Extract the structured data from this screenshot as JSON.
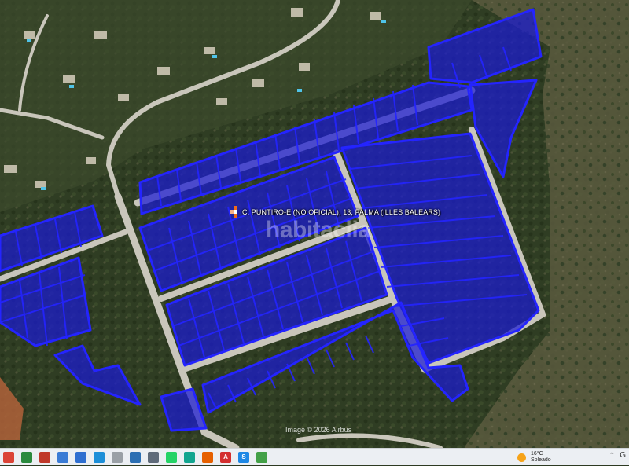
{
  "map": {
    "place_label": "C. PUNTIRO-E (NO OFICIAL), 13, PALMA (ILLES BALEARS)",
    "watermark": "habitaclia",
    "imagery_credit": "Image © 2026 Airbus",
    "colors": {
      "terrain": "#2d3a22",
      "terrain_light": "#4a5234",
      "road": "#c9c6bb",
      "parcel_fill": "#1a1ad2",
      "parcel_stroke": "#2424ff",
      "marker_orange": "#f06a1a"
    }
  },
  "taskbar": {
    "apps": [
      {
        "name": "chrome-icon",
        "color": "#db4437",
        "glyph": ""
      },
      {
        "name": "sheets-icon",
        "color": "#2b8a3e",
        "glyph": ""
      },
      {
        "name": "presentation-icon",
        "color": "#c0392b",
        "glyph": ""
      },
      {
        "name": "file-explorer-icon",
        "color": "#3a7bd5",
        "glyph": ""
      },
      {
        "name": "photos-icon",
        "color": "#2f6fd0",
        "glyph": ""
      },
      {
        "name": "edge-icon",
        "color": "#1d8fd8",
        "glyph": ""
      },
      {
        "name": "document-icon",
        "color": "#9aa0a6",
        "glyph": ""
      },
      {
        "name": "app-blue-icon",
        "color": "#2c6fb3",
        "glyph": ""
      },
      {
        "name": "settings-icon",
        "color": "#5f6b7a",
        "glyph": ""
      },
      {
        "name": "whatsapp-icon",
        "color": "#25d366",
        "glyph": ""
      },
      {
        "name": "copilot-icon",
        "color": "#12a58f",
        "glyph": ""
      },
      {
        "name": "firefox-icon",
        "color": "#e66000",
        "glyph": ""
      },
      {
        "name": "acrobat-icon",
        "color": "#d32f2f",
        "glyph": "A"
      },
      {
        "name": "app-s-icon",
        "color": "#1e88e5",
        "glyph": "S"
      },
      {
        "name": "app-green-icon",
        "color": "#43a047",
        "glyph": ""
      }
    ],
    "weather": {
      "temperature": "16°C",
      "condition": "Soleado"
    }
  }
}
